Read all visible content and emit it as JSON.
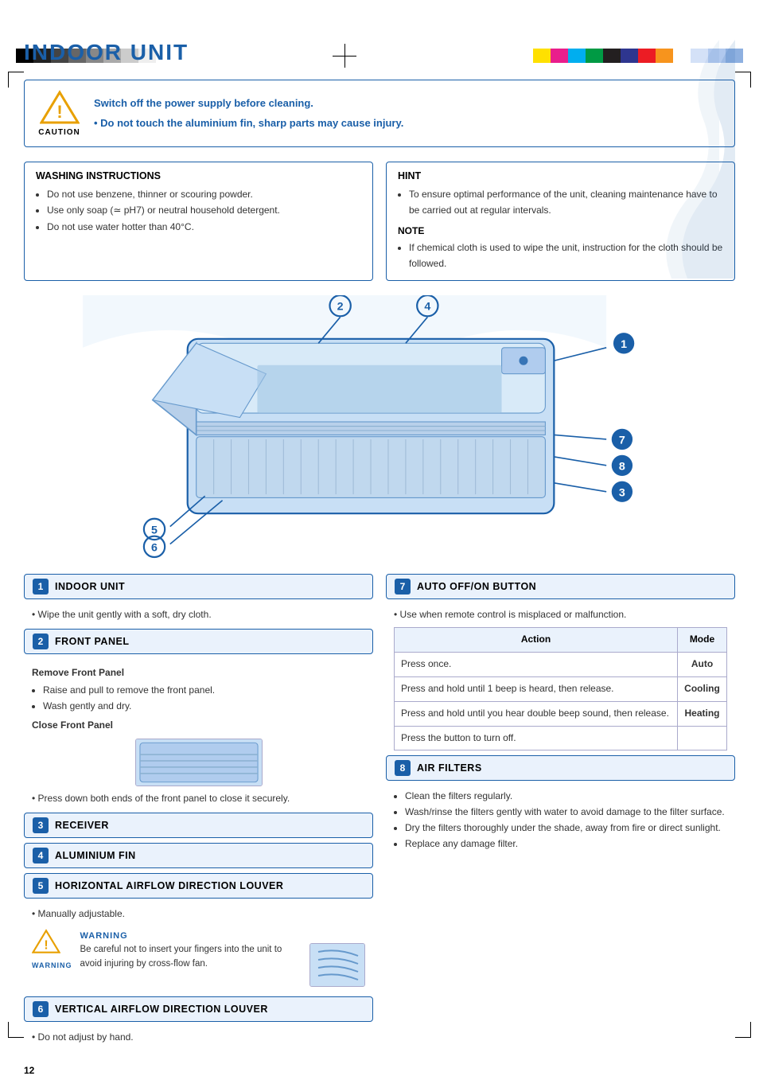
{
  "page": {
    "title": "INDOOR UNIT",
    "page_number": "12"
  },
  "caution": {
    "label": "CAUTION",
    "lines": [
      "Switch off the power supply before cleaning.",
      "Do not touch the aluminium fin, sharp parts may cause injury."
    ]
  },
  "washing_instructions": {
    "title": "WASHING  INSTRUCTIONS",
    "items": [
      "Do not use benzene, thinner or scouring powder.",
      "Use only soap (≃ pH7) or neutral household detergent.",
      "Do not use water hotter than 40°C."
    ]
  },
  "hint": {
    "title": "HINT",
    "text": "To ensure optimal performance of the unit, cleaning maintenance have to be carried out at regular intervals."
  },
  "note": {
    "title": "NOTE",
    "text": "If chemical cloth is used to wipe the unit, instruction for the cloth should be followed."
  },
  "sections": {
    "s1": {
      "num": "1",
      "title": "INDOOR UNIT",
      "body": "Wipe the unit gently with a soft, dry cloth."
    },
    "s2": {
      "num": "2",
      "title": "FRONT PANEL",
      "remove_title": "Remove Front Panel",
      "remove_items": [
        "Raise and pull to remove the front panel.",
        "Wash gently and dry."
      ],
      "close_title": "Close Front Panel",
      "close_text": "Press down both ends of the front panel to close it securely."
    },
    "s3": {
      "num": "3",
      "title": "RECEIVER"
    },
    "s4": {
      "num": "4",
      "title": "ALUMINIUM FIN"
    },
    "s5": {
      "num": "5",
      "title": "HORIZONTAL AIRFLOW DIRECTION LOUVER",
      "manual": "Manually adjustable.",
      "warning_label": "WARNING",
      "warning_text": "Be careful not to insert your fingers into the unit to avoid injuring by cross-flow fan."
    },
    "s6": {
      "num": "6",
      "title": "VERTICAL AIRFLOW DIRECTION LOUVER",
      "body": "Do not adjust by hand."
    },
    "s7": {
      "num": "7",
      "title": "AUTO OFF/ON BUTTON",
      "body": "Use when remote control is misplaced or malfunction.",
      "table_headers": [
        "Action",
        "Mode"
      ],
      "table_rows": [
        [
          "Press once.",
          "Auto"
        ],
        [
          "Press and hold until 1 beep is heard, then release.",
          "Cooling"
        ],
        [
          "Press and hold until you hear double beep sound, then release.",
          "Heating"
        ],
        [
          "Press the button to turn off.",
          ""
        ]
      ]
    },
    "s8": {
      "num": "8",
      "title": "AIR FILTERS",
      "items": [
        "Clean the filters regularly.",
        "Wash/rinse the filters gently with water to avoid damage to the filter surface.",
        "Dry the filters thoroughly under the shade, away from fire or direct sunlight.",
        "Replace any damage filter."
      ]
    }
  },
  "colors": {
    "blue": "#1a5fa8",
    "light_blue_bg": "#eaf2fc",
    "border": "#1a5fa8"
  }
}
